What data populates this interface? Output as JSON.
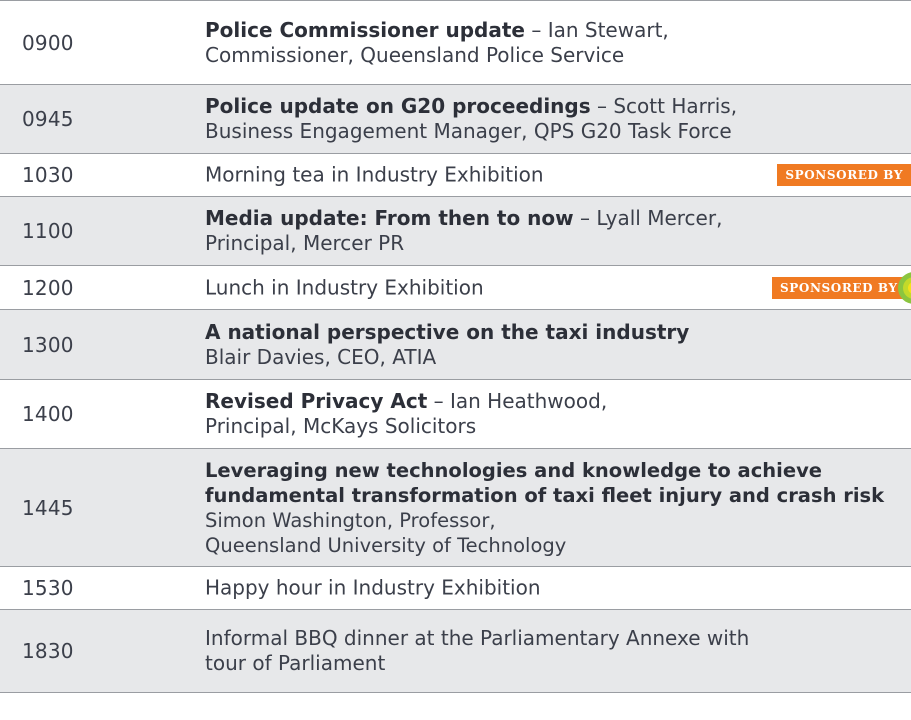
{
  "rows": [
    {
      "time": "0900",
      "title": "Police Commissioner update",
      "sep": " – ",
      "line1_rest": "Ian Stewart,",
      "line2": "Commissioner, Queensland Police Service"
    },
    {
      "time": "0945",
      "title": "Police update on G20 proceedings",
      "sep": " – ",
      "line1_rest": "Scott Harris,",
      "line2": "Business Engagement Manager, QPS G20 Task Force"
    },
    {
      "time": "1030",
      "line1_rest": "Morning tea in Industry Exhibition",
      "sponsor": "SPONSORED BY"
    },
    {
      "time": "1100",
      "title": "Media update: From then to now",
      "sep": " – ",
      "line1_rest": "Lyall Mercer,",
      "line2": "Principal, Mercer PR"
    },
    {
      "time": "1200",
      "line1_rest": "Lunch in Industry Exhibition",
      "sponsor": "SPONSORED BY",
      "logo": "bp-helios-logo"
    },
    {
      "time": "1300",
      "title": "A national perspective on the taxi industry",
      "line2": "Blair Davies, CEO, ATIA"
    },
    {
      "time": "1400",
      "title": "Revised Privacy Act",
      "sep": " – ",
      "line1_rest": "Ian Heathwood,",
      "line2": "Principal, McKays Solicitors"
    },
    {
      "time": "1445",
      "title": "Leveraging new technologies and knowledge to achieve",
      "title2": "fundamental transformation of taxi fleet injury and crash risk",
      "line2": "Simon Washington, Professor,",
      "line3": "Queensland University of Technology"
    },
    {
      "time": "1530",
      "line1_rest": "Happy hour in Industry Exhibition"
    },
    {
      "time": "1830",
      "line1_rest": "Informal BBQ dinner at the Parliamentary Annexe with",
      "line2": "tour of Parliament"
    }
  ],
  "colors": {
    "shade": "#e7e8ea",
    "rule": "#9a9da2",
    "sponsor_bg": "#f07a22",
    "text": "#3b3f4a"
  }
}
